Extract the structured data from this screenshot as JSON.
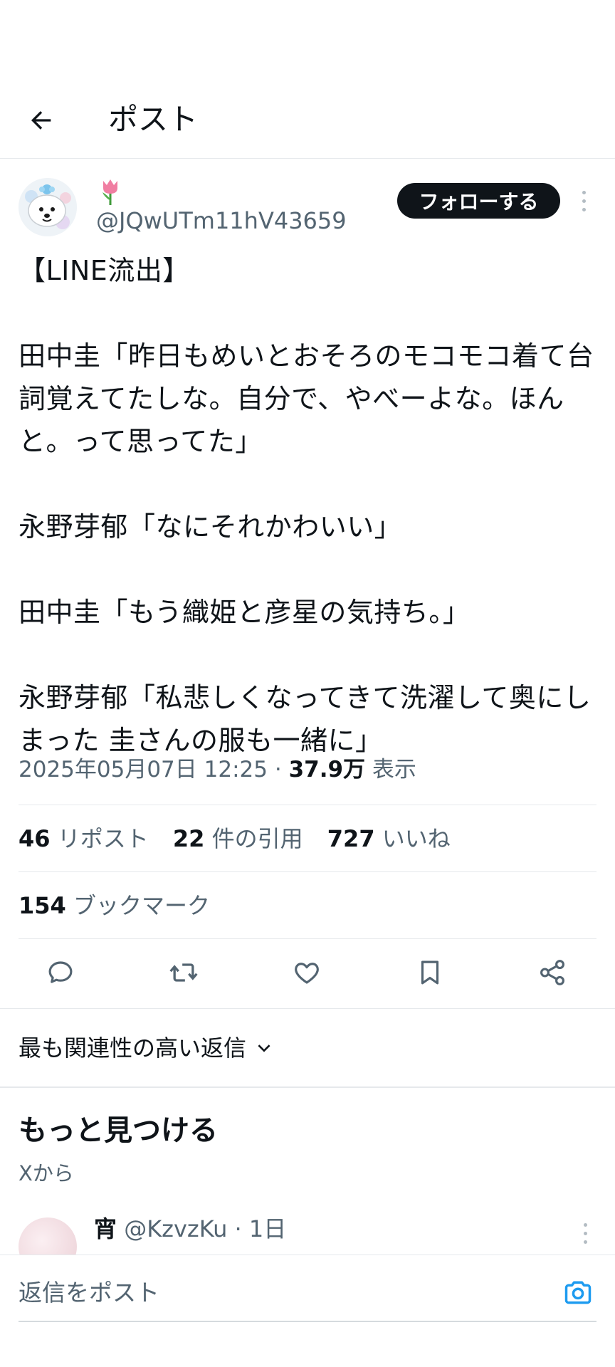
{
  "header": {
    "title": "ポスト"
  },
  "author": {
    "emoji": "🌷",
    "handle": "@JQwUTm11hV43659",
    "follow_label": "フォローする"
  },
  "tweet": {
    "text": "【LINE流出】\n\n田中圭「昨日もめいとおそろのモコモコ着て台詞覚えてたしな。自分で、やべーよな。ほんと。って思ってた」\n\n永野芽郁「なにそれかわいい」\n\n田中圭「もう織姫と彦星の気持ち。」\n\n永野芽郁「私悲しくなってきて洗濯して奥にしまった 圭さんの服も一緒に」",
    "timestamp": "2025年05月07日 12:25",
    "separator": "·",
    "views_count": "37.9万",
    "views_label": "表示"
  },
  "stats": {
    "reposts_count": "46",
    "reposts_label": "リポスト",
    "quotes_count": "22",
    "quotes_label": "件の引用",
    "likes_count": "727",
    "likes_label": "いいね",
    "bookmarks_count": "154",
    "bookmarks_label": "ブックマーク"
  },
  "sort": {
    "label": "最も関連性の高い返信"
  },
  "discover": {
    "title": "もっと見つける",
    "subtitle": "Xから"
  },
  "reply_preview": {
    "name": "宵",
    "handle": "@KzvzKu",
    "separator": "·",
    "time": "1日"
  },
  "composer": {
    "placeholder": "返信をポスト"
  },
  "colors": {
    "text": "#0f1419",
    "secondary": "#536471",
    "accent": "#1d9bf0",
    "divider": "#e6e9ec"
  },
  "icons": [
    "back-arrow-icon",
    "more-icon",
    "reply-icon",
    "repost-icon",
    "like-icon",
    "bookmark-icon",
    "share-icon",
    "chevron-down-icon",
    "camera-icon"
  ]
}
